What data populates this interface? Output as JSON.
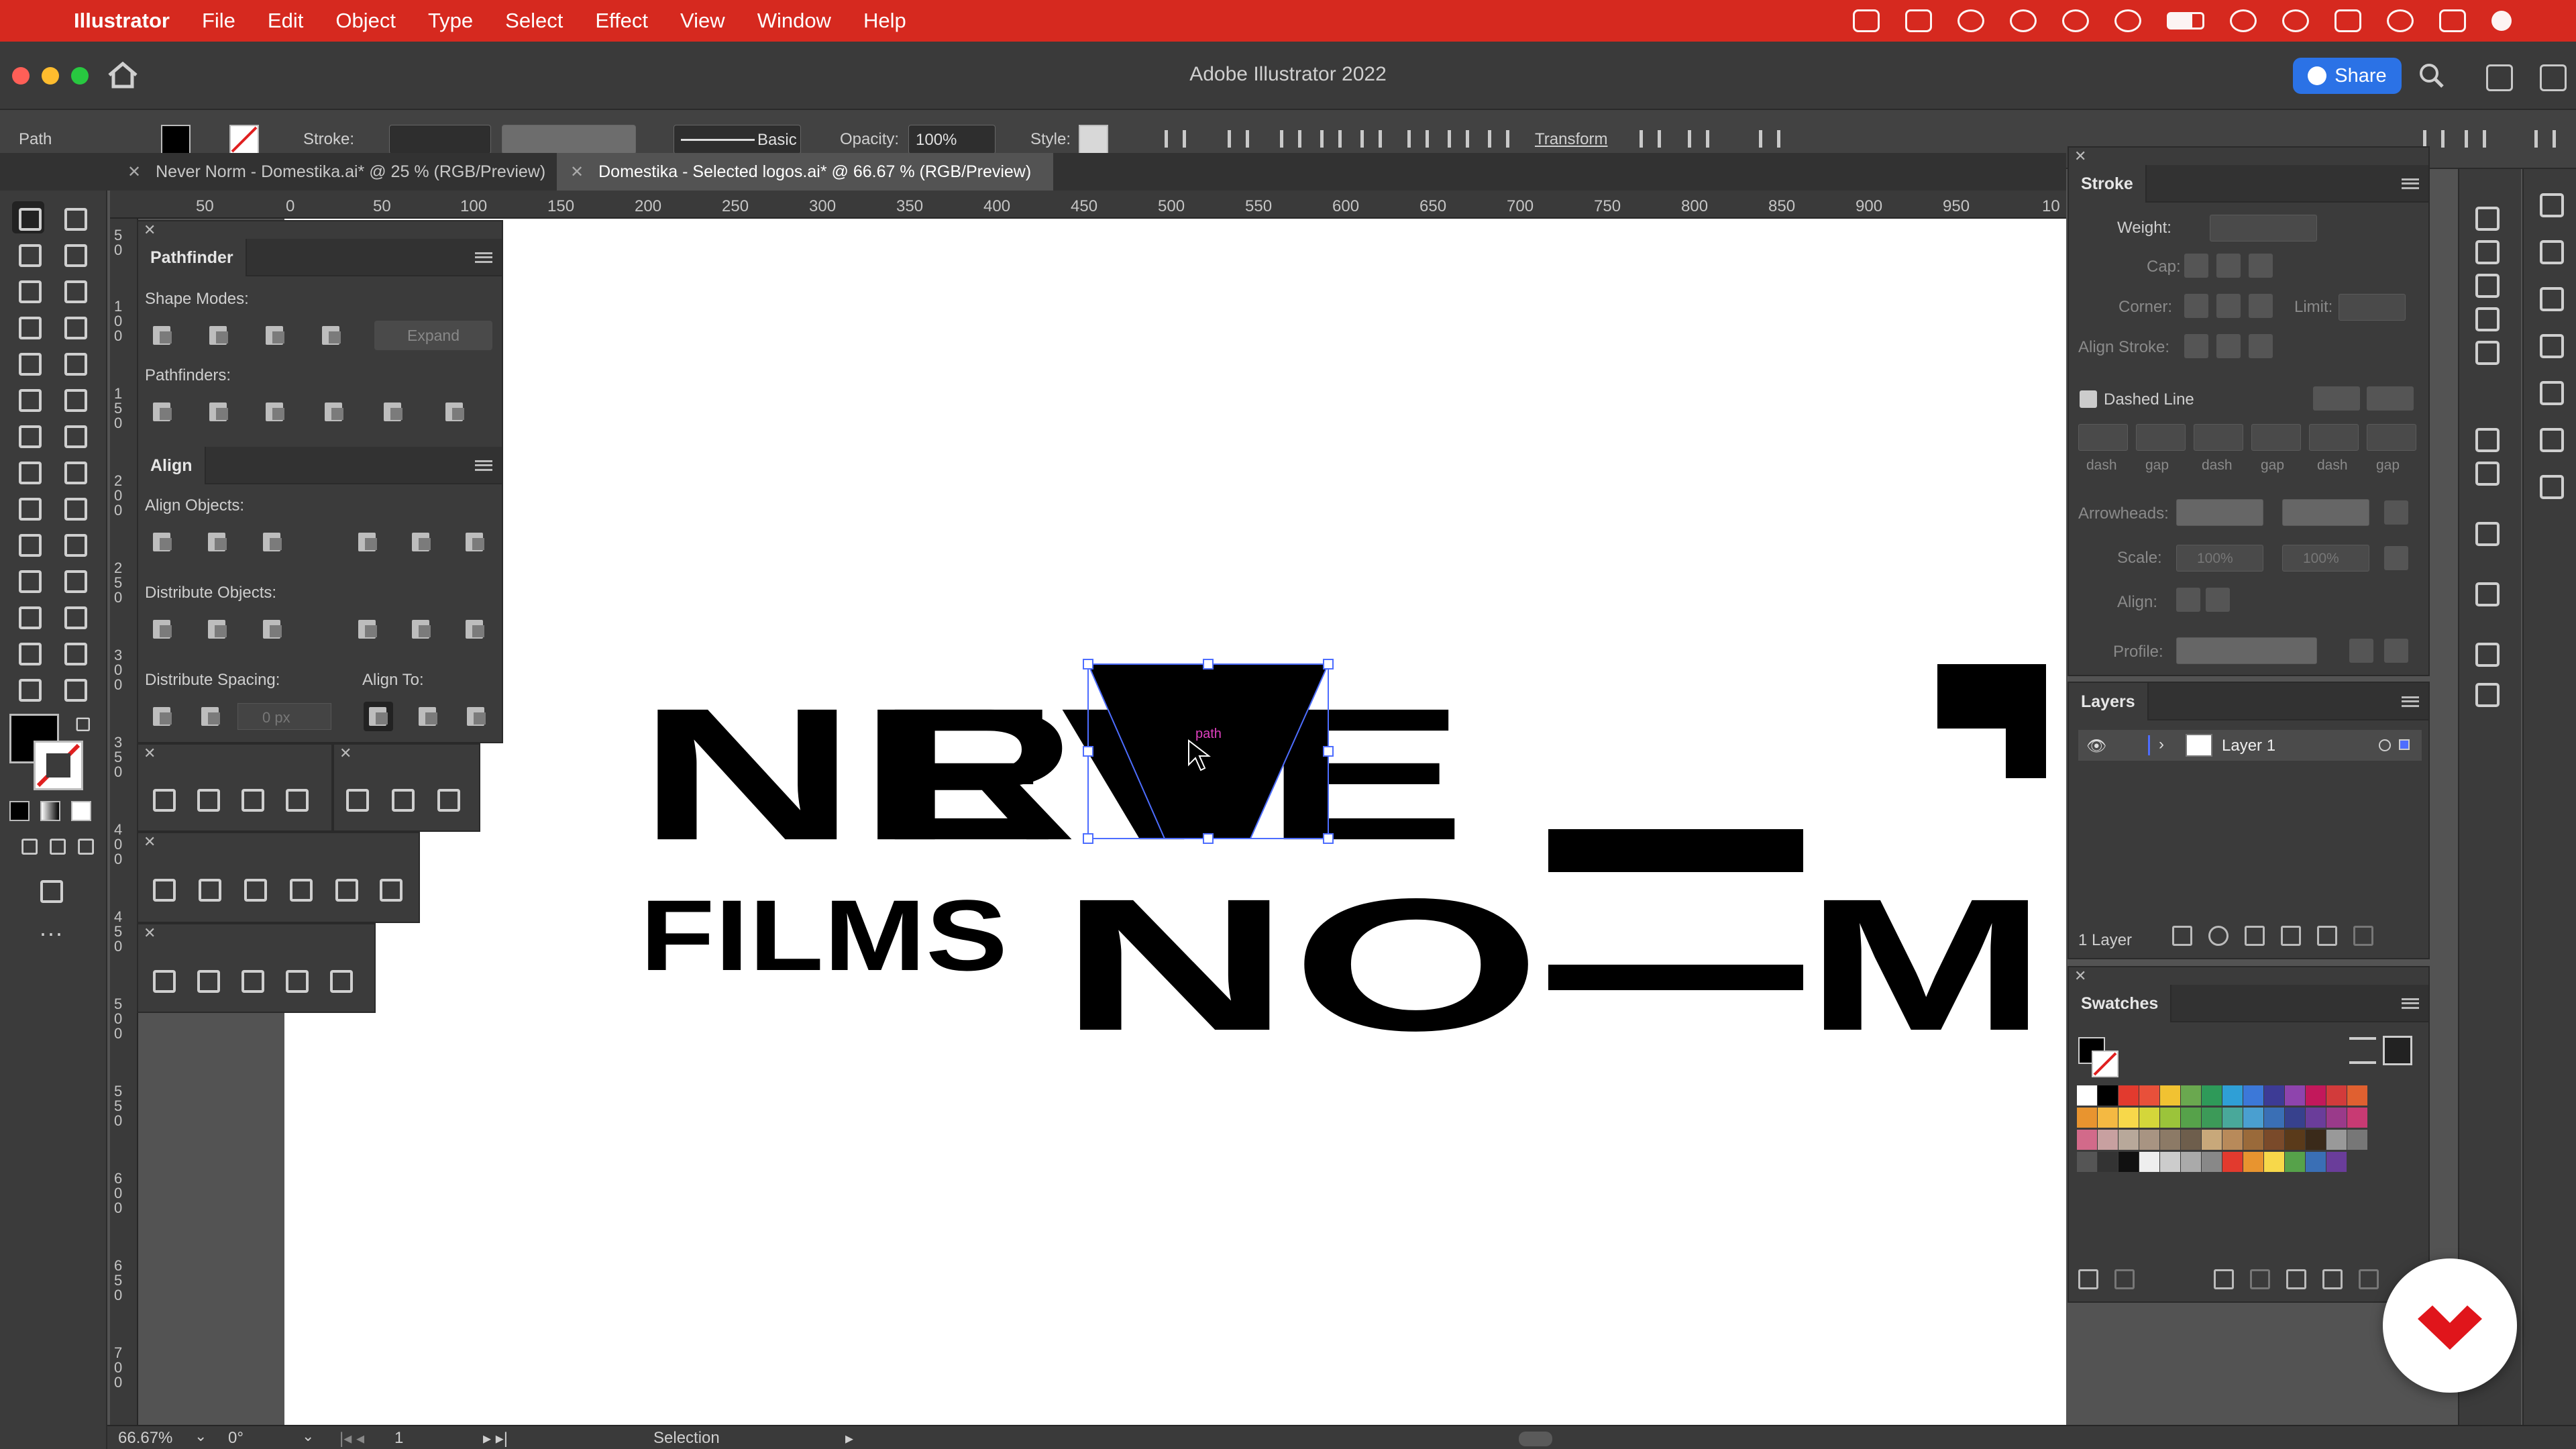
{
  "menubar": {
    "items": [
      "Illustrator",
      "File",
      "Edit",
      "Object",
      "Type",
      "Select",
      "Effect",
      "View",
      "Window",
      "Help"
    ]
  },
  "window": {
    "title": "Adobe Illustrator 2022",
    "share_label": "Share"
  },
  "control": {
    "selection_kind": "Path",
    "stroke_label": "Stroke:",
    "brush_label": "Basic",
    "opacity_label": "Opacity:",
    "opacity_value": "100%",
    "style_label": "Style:",
    "transform_label": "Transform"
  },
  "tabs": [
    {
      "label": "Never Norm - Domestika.ai* @ 25 % (RGB/Preview)"
    },
    {
      "label": "Domestika - Selected logos.ai* @ 66.67 % (RGB/Preview)"
    }
  ],
  "ruler_h": [
    "50",
    "0",
    "50",
    "100",
    "150",
    "200",
    "250",
    "300",
    "350",
    "400",
    "450",
    "500",
    "550",
    "600",
    "650",
    "700",
    "750",
    "800",
    "850",
    "900",
    "950",
    "10"
  ],
  "ruler_v": [
    "5\n0",
    "1\n0\n0",
    "1\n5\n0",
    "2\n0\n0",
    "2\n5\n0",
    "3\n0\n0",
    "3\n5\n0",
    "4\n0\n0",
    "4\n5\n0",
    "5\n0\n0",
    "5\n5\n0",
    "6\n0\n0",
    "6\n5\n0",
    "7\n0\n0"
  ],
  "pathfinder": {
    "title": "Pathfinder",
    "shape_modes": "Shape Modes:",
    "expand": "Expand",
    "pathfinders": "Pathfinders:"
  },
  "align": {
    "title": "Align",
    "align_objects": "Align Objects:",
    "distribute_objects": "Distribute Objects:",
    "distribute_spacing": "Distribute Spacing:",
    "align_to": "Align To:",
    "spacing_value": "0 px"
  },
  "artwork": {
    "word_never": "NEVE",
    "letter_r": "R",
    "word_films": "FILMS",
    "word_no": "NO",
    "letter_m": "M",
    "hover_label": "path"
  },
  "stroke_panel": {
    "title": "Stroke",
    "weight": "Weight:",
    "cap": "Cap:",
    "corner": "Corner:",
    "limit": "Limit:",
    "align_stroke": "Align Stroke:",
    "dashed_line": "Dashed Line",
    "dash_labels": [
      "dash",
      "gap",
      "dash",
      "gap",
      "dash",
      "gap"
    ],
    "arrowheads": "Arrowheads:",
    "scale": "Scale:",
    "scale_value_1": "100%",
    "scale_value_2": "100%",
    "align": "Align:",
    "profile": "Profile:"
  },
  "layers_panel": {
    "title": "Layers",
    "layer_name": "Layer 1",
    "count": "1 Layer"
  },
  "swatches_panel": {
    "title": "Swatches",
    "colors": [
      "#ffffff",
      "#000000",
      "#e23a2e",
      "#e8503a",
      "#f1c232",
      "#6aa84f",
      "#2e9a59",
      "#2f9fd6",
      "#3c78d8",
      "#3d3b95",
      "#8e44ad",
      "#c2185b",
      "#d23b3b",
      "#e06030",
      "#e8942f",
      "#f4b942",
      "#f7d84a",
      "#d4d63a",
      "#9bc43a",
      "#56a24a",
      "#3c9a58",
      "#49a89a",
      "#4a9fd0",
      "#3a6fb5",
      "#37418d",
      "#6a3d9a",
      "#9a3a8a",
      "#c83a73",
      "#d26a8a",
      "#c8a0a0",
      "#b8a89a",
      "#a89482",
      "#8c7a66",
      "#6e5e4c",
      "#c8a87a",
      "#b88a5a",
      "#9a6a3a",
      "#7a4a2a",
      "#5a3a1a",
      "#3a2a1a",
      "#999999",
      "#777777",
      "#555555",
      "#333333",
      "#111111",
      "#eeeeee",
      "#cccccc",
      "#aaaaaa",
      "#888888",
      "#e23a2e",
      "#e8942f",
      "#f7d84a",
      "#56a24a",
      "#3a6fb5",
      "#6a3d9a"
    ]
  },
  "status": {
    "zoom": "66.67%",
    "rotation": "0°",
    "artboard": "1",
    "tool": "Selection"
  }
}
